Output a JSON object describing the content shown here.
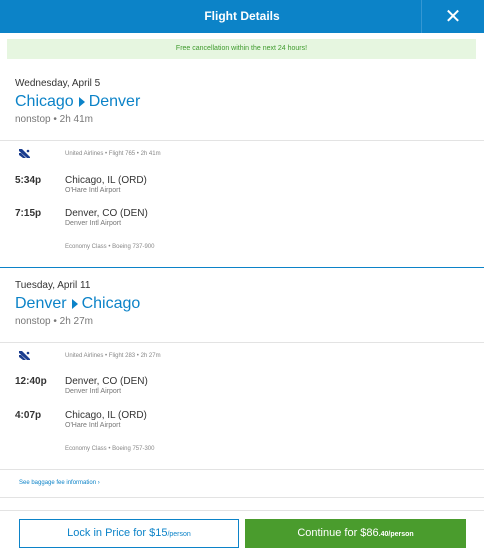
{
  "header": {
    "title": "Flight Details",
    "close_label": "✕"
  },
  "banner": {
    "text": "Free cancellation within the next 24 hours!"
  },
  "legs": [
    {
      "date": "Wednesday, April 5",
      "origin": "Chicago",
      "destination": "Denver",
      "summary": "nonstop • 2h 41m",
      "carrier_info": "United Airlines • Flight 765 • 2h 41m",
      "depart": {
        "time": "5:34p",
        "city": "Chicago, IL (ORD)",
        "airport": "O'Hare Intl Airport"
      },
      "arrive": {
        "time": "7:15p",
        "city": "Denver, CO (DEN)",
        "airport": "Denver Intl Airport"
      },
      "cabin": "Economy Class • Boeing 737-900"
    },
    {
      "date": "Tuesday, April 11",
      "origin": "Denver",
      "destination": "Chicago",
      "summary": "nonstop • 2h 27m",
      "carrier_info": "United Airlines • Flight 283 • 2h 27m",
      "depart": {
        "time": "12:40p",
        "city": "Denver, CO (DEN)",
        "airport": "Denver Intl Airport"
      },
      "arrive": {
        "time": "4:07p",
        "city": "Chicago, IL (ORD)",
        "airport": "O'Hare Intl Airport"
      },
      "cabin": "Economy Class • Boeing 757-300"
    }
  ],
  "baggage_link": "See baggage fee information ›",
  "actions": {
    "lock_main": "Lock in Price for $15",
    "lock_unit": "/person",
    "continue_main": "Continue for $86",
    "continue_cents": ".40/person"
  },
  "colors": {
    "accent": "#0c83c8",
    "header_bg": "#0c83c8",
    "continue_bg": "#4a9c2d",
    "banner_bg": "#e6f6e0",
    "banner_text": "#3e9a2c"
  },
  "icons": {
    "close": "close-icon",
    "airline": "united-airlines-logo-icon",
    "route_arrow": "triangle-right-icon"
  }
}
